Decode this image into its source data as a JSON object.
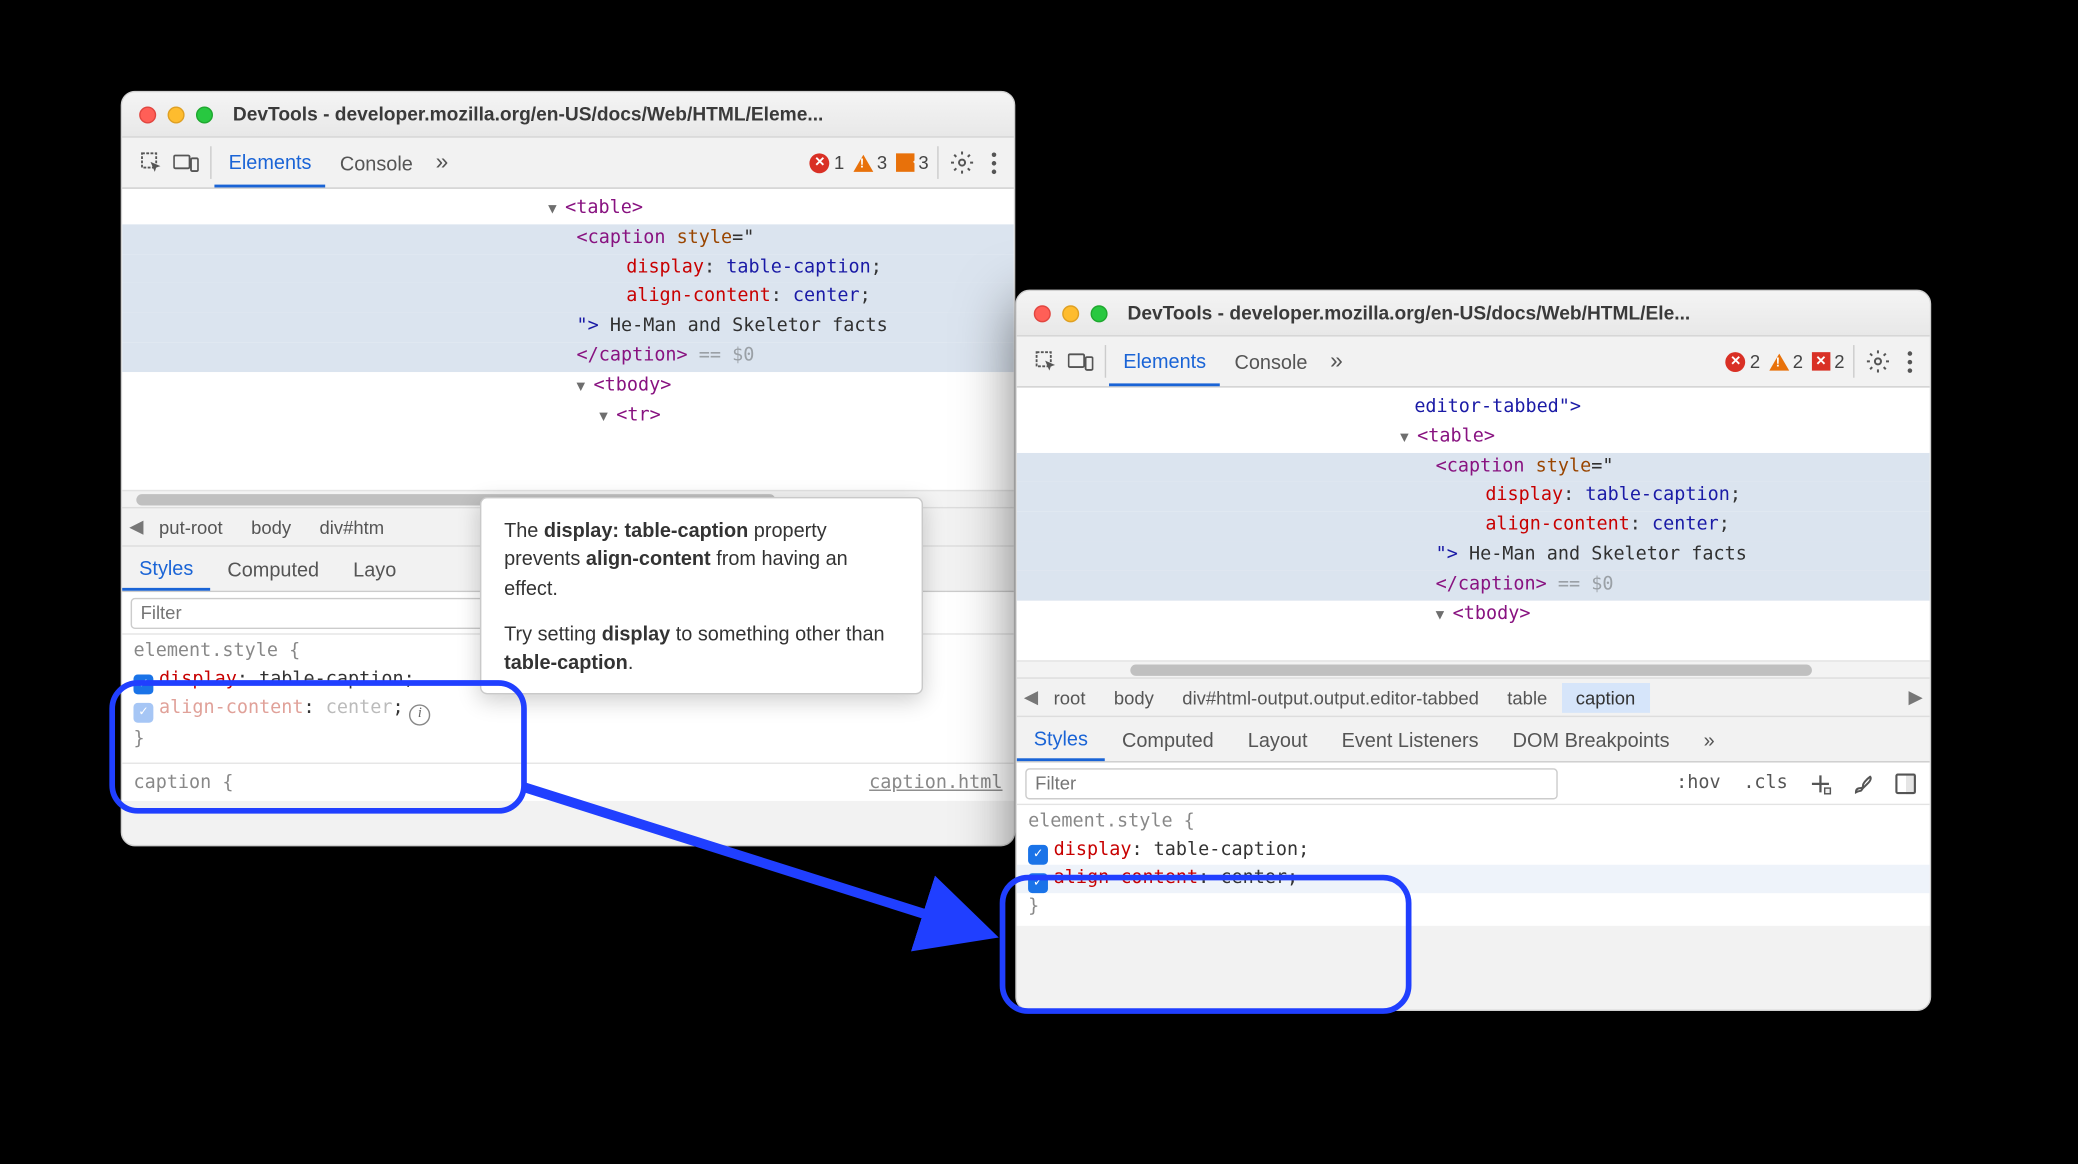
{
  "windowA": {
    "title": "DevTools - developer.mozilla.org/en-US/docs/Web/HTML/Eleme...",
    "tabs": {
      "elements": "Elements",
      "console": "Console",
      "more": "»"
    },
    "badges": {
      "errors": "1",
      "warnings": "3",
      "flags": "3"
    },
    "dom": {
      "table_open": "<table>",
      "caption_open_1": "<caption",
      "caption_open_2": "style",
      "caption_open_3": "=\"",
      "css_display_prop": "display",
      "css_display_val": "table-caption",
      "css_align_prop": "align-content",
      "css_align_val": "center",
      "quote_close": "\"> ",
      "caption_text": "He-Man and Skeletor facts",
      "caption_close": "</caption>",
      "sel_mark": " == $0",
      "tbody_open": "<tbody>",
      "tr_open": "<tr>"
    },
    "breadcrumbs": {
      "bc0": "put-root",
      "bc1": "body",
      "bc2": "div#htm"
    },
    "subtabs": {
      "styles": "Styles",
      "computed": "Computed",
      "layout": "Layo"
    },
    "filter": {
      "placeholder": "Filter"
    },
    "styles": {
      "selector": "element.style {",
      "display_prop": "display",
      "display_val": "table-caption",
      "align_prop": "align-content",
      "align_val": "center",
      "close": "}",
      "caption_rule": "caption {",
      "src": "caption.html"
    }
  },
  "tooltip": {
    "l1a": "The ",
    "l1b": "display: table-caption",
    "l1c": " property prevents ",
    "l1d": "align-content",
    "l1e": " from having an effect.",
    "l2a": "Try setting ",
    "l2b": "display",
    "l2c": " to something other than ",
    "l2d": "table-caption",
    "l2e": "."
  },
  "windowB": {
    "title": "DevTools - developer.mozilla.org/en-US/docs/Web/HTML/Ele...",
    "tabs": {
      "elements": "Elements",
      "console": "Console",
      "more": "»"
    },
    "badges": {
      "errors": "2",
      "warnings": "2",
      "issues": "2"
    },
    "dom": {
      "prev_line": "editor-tabbed\">",
      "table_open": "<table>",
      "caption_open_1": "<caption",
      "caption_open_2": "style",
      "caption_open_3": "=\"",
      "css_display_prop": "display",
      "css_display_val": "table-caption",
      "css_align_prop": "align-content",
      "css_align_val": "center",
      "quote_close": "\"> ",
      "caption_text": "He-Man and Skeletor facts",
      "caption_close": "</caption>",
      "sel_mark": " == $0",
      "tbody_open": "<tbody>"
    },
    "breadcrumbs": {
      "bc0": "root",
      "bc1": "body",
      "bc2": "div#html-output.output.editor-tabbed",
      "bc3": "table",
      "bc4": "caption"
    },
    "subtabs": {
      "styles": "Styles",
      "computed": "Computed",
      "layout": "Layout",
      "events": "Event Listeners",
      "domb": "DOM Breakpoints",
      "more": "»"
    },
    "filter": {
      "placeholder": "Filter",
      "hov": ":hov",
      "cls": ".cls"
    },
    "styles": {
      "selector": "element.style {",
      "display_prop": "display",
      "display_val": "table-caption",
      "align_prop": "align-content",
      "align_val": "center",
      "close": "}"
    }
  }
}
